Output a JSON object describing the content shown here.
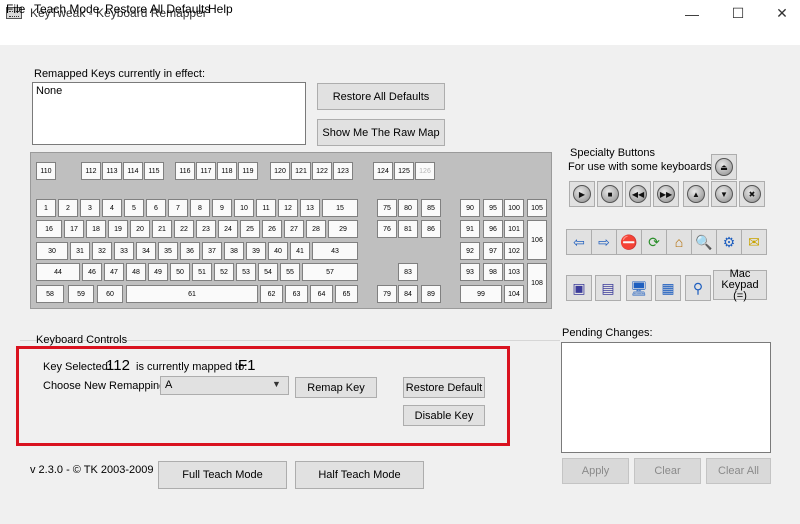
{
  "window": {
    "title": "KeyTweak -  Keyboard Remapper",
    "minimize_glyph": "—",
    "maximize_glyph": "☐",
    "close_glyph": "✕"
  },
  "menu": [
    "File",
    "Teach Mode",
    "Restore All Defaults",
    "Help"
  ],
  "remapped": {
    "label": "Remapped Keys currently in effect:",
    "value": "None"
  },
  "buttons": {
    "restore_all": "Restore All Defaults",
    "show_raw": "Show Me The Raw Map",
    "remap": "Remap Key",
    "restore_default": "Restore Default",
    "disable": "Disable Key",
    "full_teach": "Full Teach Mode",
    "half_teach": "Half Teach Mode",
    "apply": "Apply",
    "clear": "Clear",
    "clear_all": "Clear All"
  },
  "keys": {
    "fn": [
      "110",
      "112",
      "113",
      "114",
      "115",
      "116",
      "117",
      "118",
      "119",
      "120",
      "121",
      "122",
      "123",
      "124",
      "125",
      "126"
    ],
    "row1": [
      "1",
      "2",
      "3",
      "4",
      "5",
      "6",
      "7",
      "8",
      "9",
      "10",
      "11",
      "12",
      "13",
      "15"
    ],
    "row2": [
      "16",
      "17",
      "18",
      "19",
      "20",
      "21",
      "22",
      "23",
      "24",
      "25",
      "26",
      "27",
      "28",
      "29"
    ],
    "row3": [
      "30",
      "31",
      "32",
      "33",
      "34",
      "35",
      "36",
      "37",
      "38",
      "39",
      "40",
      "41",
      "43"
    ],
    "row4": [
      "44",
      "46",
      "47",
      "48",
      "49",
      "50",
      "51",
      "52",
      "53",
      "54",
      "55",
      "57"
    ],
    "row5": [
      "58",
      "59",
      "60",
      "61",
      "62",
      "63",
      "64",
      "65"
    ],
    "nav1": [
      "75",
      "80",
      "85"
    ],
    "nav2": [
      "76",
      "81",
      "86"
    ],
    "arrows": [
      "83",
      "79",
      "84",
      "89"
    ],
    "num1": [
      "90",
      "95",
      "100",
      "105"
    ],
    "num2": [
      "91",
      "96",
      "101"
    ],
    "num_plus": "106",
    "num3": [
      "92",
      "97",
      "102"
    ],
    "num4": [
      "93",
      "98",
      "103"
    ],
    "num_enter": "108",
    "num5": [
      "99",
      "104"
    ]
  },
  "specialty": {
    "title": "Specialty Buttons",
    "subtitle": "For use with some keyboards",
    "mac_keypad": "Mac Keypad (=)",
    "icons": [
      "eject-icon",
      "play-icon",
      "stop-icon",
      "rewind-icon",
      "fast-forward-icon",
      "volume-up-icon",
      "volume-down-icon",
      "mute-icon",
      "back-arrow-icon",
      "forward-arrow-icon",
      "stop-browser-icon",
      "refresh-icon",
      "home-icon",
      "search-icon",
      "favorites-icon",
      "mail-icon",
      "media-icon",
      "my-computer-icon",
      "computer-icon",
      "calculator-icon",
      "magnifier-icon"
    ]
  },
  "controls": {
    "group_label": "Keyboard Controls",
    "key_selected_label": "Key Selected:",
    "key_selected_value": "112",
    "mapped_label": "is currently mapped to:",
    "mapped_value": "F1",
    "choose_label": "Choose New Remapping",
    "choose_value": "A"
  },
  "pending": {
    "label": "Pending Changes:"
  },
  "footer": {
    "version": "v 2.3.0 - © TK 2003-2009"
  },
  "colors": {
    "highlight": "#d9121f",
    "keyboard_bg": "#bfbfbf"
  }
}
